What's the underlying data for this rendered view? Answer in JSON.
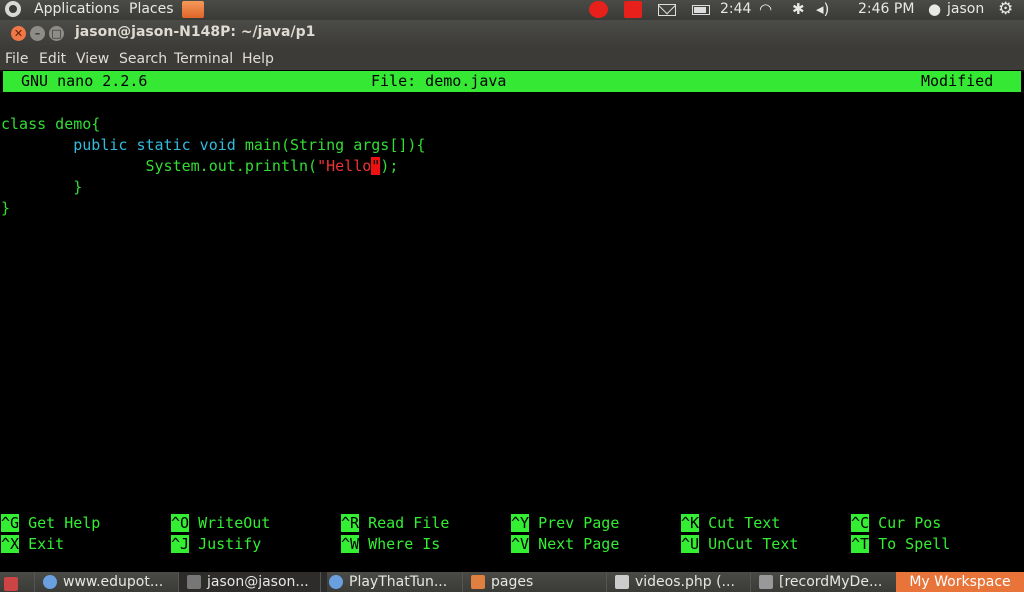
{
  "top_panel": {
    "applications": "Applications",
    "places": "Places",
    "battery_time": "2:44",
    "clock": "2:46 PM",
    "user": "jason",
    "icons": [
      "ubuntu-logo-icon",
      "folder-icon",
      "record-icon",
      "stop-icon",
      "mail-icon",
      "battery-icon",
      "wifi-icon",
      "bluetooth-icon",
      "volume-icon",
      "user-icon",
      "power-gear-icon"
    ],
    "colors": {
      "record": "#e8201c"
    }
  },
  "window": {
    "title": "jason@jason-N148P: ~/java/p1"
  },
  "menu": {
    "file": "File",
    "edit": "Edit",
    "view": "View",
    "search": "Search",
    "terminal": "Terminal",
    "help": "Help"
  },
  "nano": {
    "version": "GNU nano 2.2.6",
    "file": "File: demo.java",
    "status": "Modified",
    "header_color": "#34e834",
    "code": {
      "line1": "class demo{",
      "line2_indent": "        ",
      "line2_kw": "public static void ",
      "line2_rest": "main(String args[]){",
      "line3_indent": "                ",
      "line3_a": "System.out.println(",
      "line3_str": "\"Hello",
      "line3_cursor": "\"",
      "line3_end": ");",
      "line4": "        }",
      "line5": "}"
    },
    "shortcuts": [
      {
        "key": "^G",
        "label": "Get Help"
      },
      {
        "key": "^O",
        "label": "WriteOut"
      },
      {
        "key": "^R",
        "label": "Read File"
      },
      {
        "key": "^Y",
        "label": "Prev Page"
      },
      {
        "key": "^K",
        "label": "Cut Text"
      },
      {
        "key": "^C",
        "label": "Cur Pos"
      },
      {
        "key": "^X",
        "label": "Exit"
      },
      {
        "key": "^J",
        "label": "Justify"
      },
      {
        "key": "^W",
        "label": "Where Is"
      },
      {
        "key": "^V",
        "label": "Next Page"
      },
      {
        "key": "^U",
        "label": "UnCut Text"
      },
      {
        "key": "^T",
        "label": "To Spell"
      }
    ]
  },
  "taskbar": {
    "tasks": [
      {
        "label": "www.edupot..."
      },
      {
        "label": "jason@jason..."
      },
      {
        "label": "PlayThatTun..."
      },
      {
        "label": "pages"
      },
      {
        "label": "videos.php (..."
      },
      {
        "label": "[recordMyDe..."
      }
    ],
    "workspace": "My Workspace",
    "workspace_color": "#e8743a"
  }
}
